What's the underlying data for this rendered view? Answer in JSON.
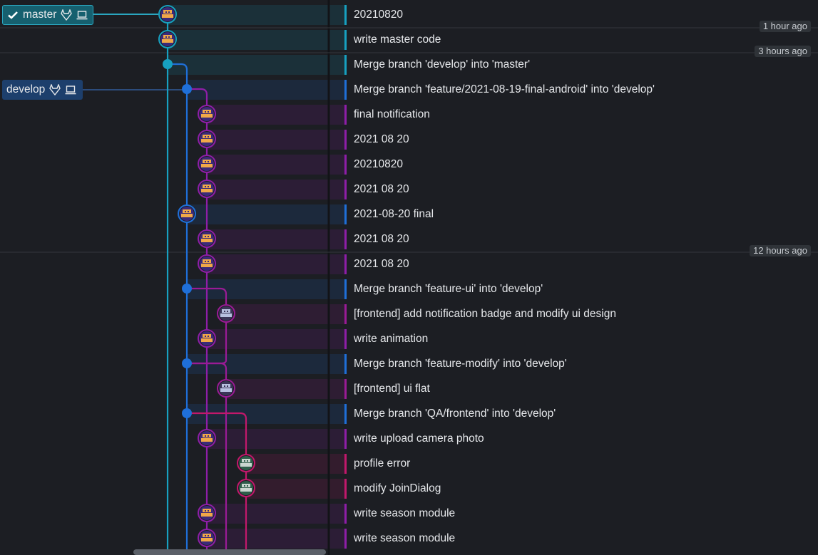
{
  "branch_tags": {
    "master": {
      "label": "master",
      "checked": true,
      "icons": [
        "check-icon",
        "gitlab-icon",
        "laptop-icon"
      ],
      "color": "#2aa6bf"
    },
    "develop": {
      "label": "develop",
      "icons": [
        "gitlab-icon",
        "laptop-icon"
      ],
      "color": "#3d7ad6"
    }
  },
  "lane_colors": [
    "#17a0c0",
    "#1f6fd8",
    "#8e1ea8",
    "#9a1b96",
    "#c2186b"
  ],
  "time_markers": [
    "1 hour ago",
    "3 hours ago",
    "12 hours ago"
  ],
  "commits": [
    {
      "message": "20210820",
      "lane": 0,
      "avatar": "orange"
    },
    {
      "message": "write master code",
      "lane": 0,
      "avatar": "orange"
    },
    {
      "message": "Merge branch 'develop' into 'master'",
      "lane": 0,
      "merge": true
    },
    {
      "message": "Merge branch 'feature/2021-08-19-final-android' into 'develop'",
      "lane": 1,
      "merge": true
    },
    {
      "message": "final notification",
      "lane": 2,
      "avatar": "orange"
    },
    {
      "message": "2021 08 20",
      "lane": 2,
      "avatar": "orange"
    },
    {
      "message": "20210820",
      "lane": 2,
      "avatar": "orange"
    },
    {
      "message": "2021 08 20",
      "lane": 2,
      "avatar": "orange"
    },
    {
      "message": "2021-08-20 final",
      "lane": 1,
      "avatar": "orange"
    },
    {
      "message": "2021 08 20",
      "lane": 2,
      "avatar": "orange"
    },
    {
      "message": "2021 08 20",
      "lane": 2,
      "avatar": "orange"
    },
    {
      "message": "Merge branch 'feature-ui' into 'develop'",
      "lane": 1,
      "merge": true
    },
    {
      "message": "[frontend] add notification badge and modify ui design",
      "lane": 3,
      "avatar": "gray"
    },
    {
      "message": "write animation",
      "lane": 2,
      "avatar": "orange"
    },
    {
      "message": "Merge branch 'feature-modify' into 'develop'",
      "lane": 1,
      "merge": true
    },
    {
      "message": "[frontend] ui flat",
      "lane": 3,
      "avatar": "gray"
    },
    {
      "message": "Merge branch 'QA/frontend' into 'develop'",
      "lane": 1,
      "merge": true
    },
    {
      "message": "write upload camera photo",
      "lane": 2,
      "avatar": "orange"
    },
    {
      "message": "profile error",
      "lane": 4,
      "avatar": "green"
    },
    {
      "message": "modify JoinDialog",
      "lane": 4,
      "avatar": "green"
    },
    {
      "message": "write season module",
      "lane": 2,
      "avatar": "orange"
    },
    {
      "message": "write season module",
      "lane": 2,
      "avatar": "orange"
    }
  ]
}
